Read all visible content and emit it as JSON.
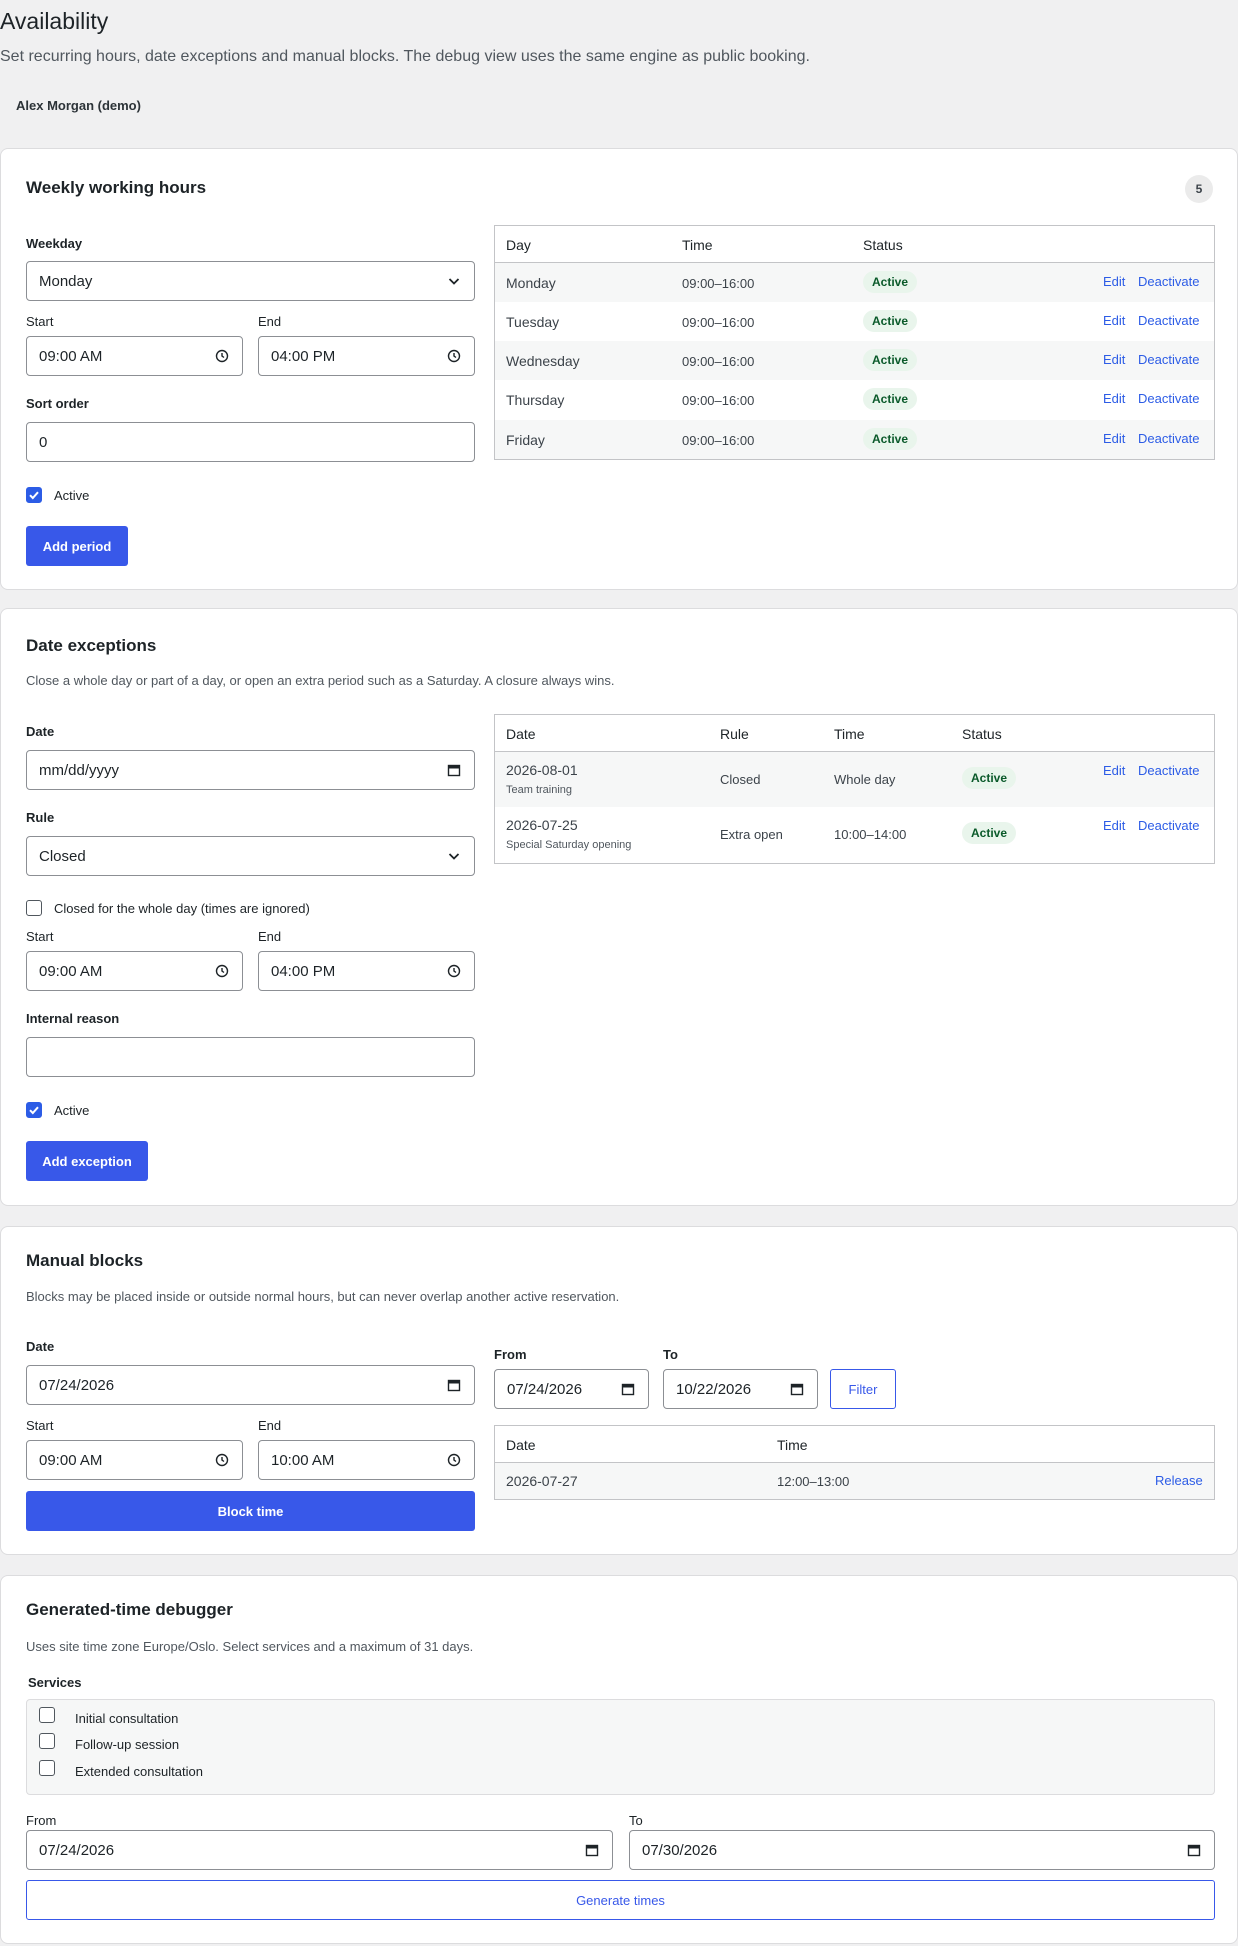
{
  "header": {
    "title": "Availability",
    "description": "Set recurring hours, date exceptions and manual blocks. The debug view uses the same engine as public booking.",
    "user": "Alex Morgan (demo)"
  },
  "weekly": {
    "title": "Weekly working hours",
    "count": "5",
    "weekday_label": "Weekday",
    "weekday_value": "Monday",
    "start_label": "Start",
    "start_value": "09:00 AM",
    "end_label": "End",
    "end_value": "04:00 PM",
    "sort_label": "Sort order",
    "sort_value": "0",
    "active_label": "Active",
    "add_button": "Add period",
    "columns": [
      "Day",
      "Time",
      "Status"
    ],
    "rows": [
      {
        "day": "Monday",
        "time": "09:00–16:00",
        "status": "Active",
        "edit": "Edit",
        "deactivate": "Deactivate"
      },
      {
        "day": "Tuesday",
        "time": "09:00–16:00",
        "status": "Active",
        "edit": "Edit",
        "deactivate": "Deactivate"
      },
      {
        "day": "Wednesday",
        "time": "09:00–16:00",
        "status": "Active",
        "edit": "Edit",
        "deactivate": "Deactivate"
      },
      {
        "day": "Thursday",
        "time": "09:00–16:00",
        "status": "Active",
        "edit": "Edit",
        "deactivate": "Deactivate"
      },
      {
        "day": "Friday",
        "time": "09:00–16:00",
        "status": "Active",
        "edit": "Edit",
        "deactivate": "Deactivate"
      }
    ]
  },
  "exceptions": {
    "title": "Date exceptions",
    "description": "Close a whole day or part of a day, or open an extra period such as a Saturday. A closure always wins.",
    "date_label": "Date",
    "date_placeholder": "mm/dd/yyyy",
    "rule_label": "Rule",
    "rule_value": "Closed",
    "whole_day_label": "Closed for the whole day (times are ignored)",
    "start_label": "Start",
    "start_value": "09:00 AM",
    "end_label": "End",
    "end_value": "04:00 PM",
    "reason_label": "Internal reason",
    "reason_value": "",
    "active_label": "Active",
    "add_button": "Add exception",
    "columns": [
      "Date",
      "Rule",
      "Time",
      "Status"
    ],
    "rows": [
      {
        "date": "2026-08-01",
        "note": "Team training",
        "rule": "Closed",
        "time": "Whole day",
        "status": "Active",
        "edit": "Edit",
        "deactivate": "Deactivate"
      },
      {
        "date": "2026-07-25",
        "note": "Special Saturday opening",
        "rule": "Extra open",
        "time": "10:00–14:00",
        "status": "Active",
        "edit": "Edit",
        "deactivate": "Deactivate"
      }
    ]
  },
  "blocks": {
    "title": "Manual blocks",
    "description": "Blocks may be placed inside or outside normal hours, but can never overlap another active reservation.",
    "date_label": "Date",
    "date_value": "07/24/2026",
    "start_label": "Start",
    "start_value": "09:00 AM",
    "end_label": "End",
    "end_value": "10:00 AM",
    "block_button": "Block time",
    "from_label": "From",
    "from_value": "07/24/2026",
    "to_label": "To",
    "to_value": "10/22/2026",
    "filter_button": "Filter",
    "columns": [
      "Date",
      "Time"
    ],
    "rows": [
      {
        "date": "2026-07-27",
        "time": "12:00–13:00",
        "release": "Release"
      }
    ]
  },
  "debugger": {
    "title": "Generated-time debugger",
    "description": "Uses site time zone Europe/Oslo. Select services and a maximum of 31 days.",
    "services_label": "Services",
    "services": [
      "Initial consultation",
      "Follow-up session",
      "Extended consultation"
    ],
    "from_label": "From",
    "from_value": "07/24/2026",
    "to_label": "To",
    "to_value": "07/30/2026",
    "generate_button": "Generate times"
  },
  "icons": {
    "chevron": "chevron-down-icon",
    "clock": "clock-icon",
    "calendar": "calendar-icon",
    "check": "check-icon"
  },
  "colors": {
    "accent": "#3858e9",
    "link": "#2c5ce6",
    "status_bg": "#e9f5ec",
    "status_text": "#0a5a2a"
  }
}
